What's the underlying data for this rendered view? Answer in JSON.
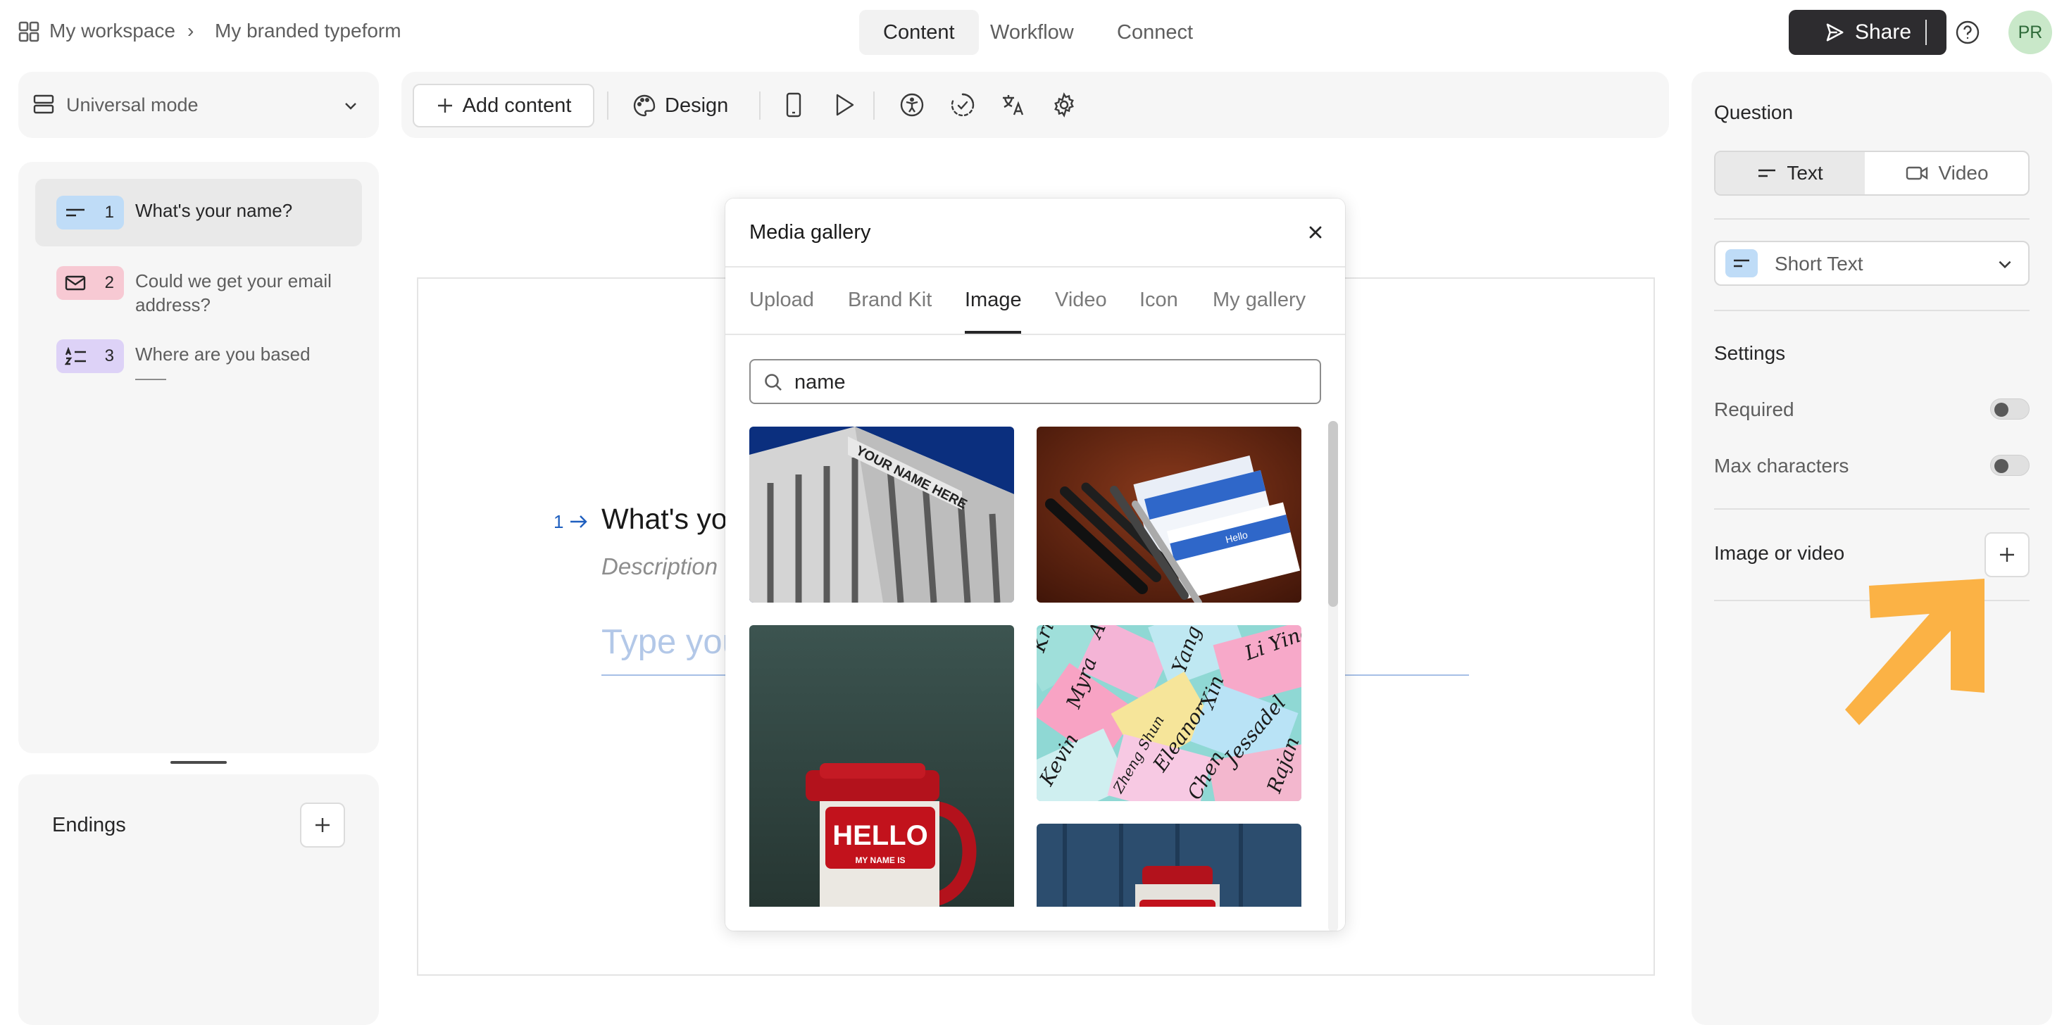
{
  "breadcrumb": {
    "workspace": "My workspace",
    "separator": "›",
    "form_name": "My branded typeform"
  },
  "top_tabs": [
    {
      "label": "Content",
      "active": true
    },
    {
      "label": "Workflow",
      "active": false
    },
    {
      "label": "Connect",
      "active": false
    }
  ],
  "header": {
    "share_label": "Share",
    "avatar_initials": "PR"
  },
  "mode_selector": {
    "label": "Universal mode"
  },
  "questions": [
    {
      "number": "1",
      "text": "What's your name?",
      "icon": "short-text-icon",
      "color": "#bfdcf7",
      "selected": true
    },
    {
      "number": "2",
      "text": "Could we get your email address?",
      "icon": "mail-icon",
      "color": "#f7c9d3",
      "selected": false
    },
    {
      "number": "3",
      "text": "Where are you based",
      "icon": "dropdown-list-icon",
      "color": "#ddd2f7",
      "selected": false
    }
  ],
  "endings": {
    "label": "Endings"
  },
  "toolbar": {
    "add_content_label": "Add content",
    "design_label": "Design"
  },
  "canvas": {
    "question_number": "1",
    "question_text": "What's yo",
    "description": "Description",
    "answer_placeholder": "Type you"
  },
  "gallery": {
    "title": "Media gallery",
    "tabs": [
      {
        "label": "Upload",
        "active": false
      },
      {
        "label": "Brand Kit",
        "active": false
      },
      {
        "label": "Image",
        "active": true
      },
      {
        "label": "Video",
        "active": false
      },
      {
        "label": "Icon",
        "active": false
      },
      {
        "label": "My gallery",
        "active": false
      }
    ],
    "search_value": "name",
    "images": {
      "building_sign": "YOUR NAME HERE",
      "mug_hello": "HELLO",
      "mug_sub": "MY NAME IS",
      "tag_hello": "Hello",
      "sticky_names": [
        "Kristen",
        "Myra",
        "Kevin",
        "Eleanor",
        "Li Yina",
        "Xin",
        "Jessadel",
        "Yang",
        "Chen",
        "Austin",
        "Zheng Shun",
        "Rajan"
      ]
    }
  },
  "right_panel": {
    "question_heading": "Question",
    "type_toggle": [
      {
        "label": "Text",
        "active": true
      },
      {
        "label": "Video",
        "active": false
      }
    ],
    "question_type": "Short Text",
    "settings_heading": "Settings",
    "settings": [
      {
        "label": "Required",
        "on": false
      },
      {
        "label": "Max characters",
        "on": false
      }
    ],
    "image_or_video_label": "Image or video"
  },
  "colors": {
    "accent_blue": "#1f5fbf",
    "arrow_annotation": "#fbb245",
    "share_bg": "#2d2c2f"
  }
}
